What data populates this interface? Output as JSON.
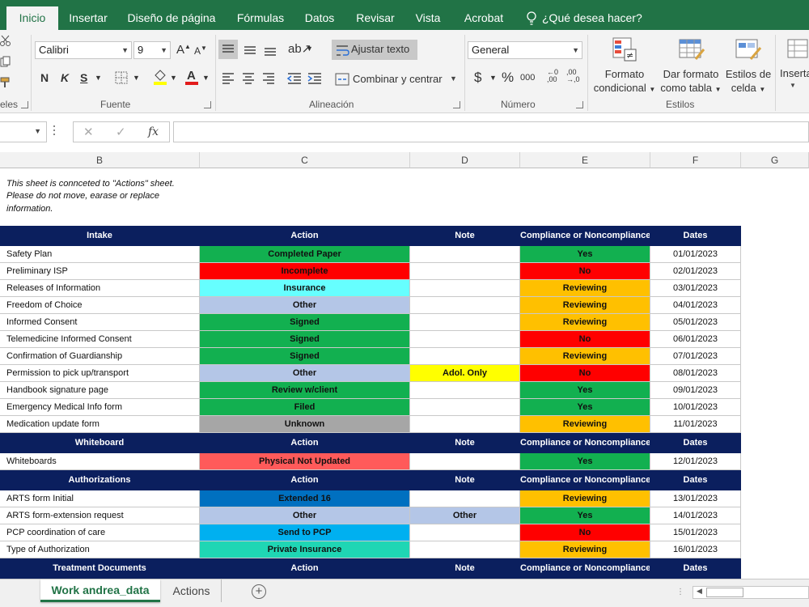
{
  "tabs": [
    "Inicio",
    "Insertar",
    "Diseño de página",
    "Fórmulas",
    "Datos",
    "Revisar",
    "Vista",
    "Acrobat",
    "¿Qué desea hacer?"
  ],
  "ribbon": {
    "font_name": "Calibri",
    "font_size": "9",
    "bold": "N",
    "italic": "K",
    "underline": "S",
    "wrap_text": "Ajustar texto",
    "merge_center": "Combinar y centrar",
    "number_format": "General",
    "currency": "$",
    "percent": "%",
    "thousands": "000",
    "cond_format": [
      "Formato",
      "condicional"
    ],
    "format_table": [
      "Dar formato",
      "como tabla"
    ],
    "cell_styles": [
      "Estilos de",
      "celda"
    ],
    "insert": "Inserta",
    "groups": {
      "clipboard": "eles",
      "font": "Fuente",
      "alignment": "Alineación",
      "number": "Número",
      "styles": "Estilos"
    }
  },
  "formula_bar": {
    "fx": "fx",
    "cancel": "✕",
    "enter": "✓"
  },
  "columns": [
    "B",
    "C",
    "D",
    "E",
    "F",
    "G"
  ],
  "notes": [
    "This sheet is connceted to \"Actions\" sheet.",
    "Please do not move, earase or replace",
    "information."
  ],
  "header_labels": {
    "action": "Action",
    "note": "Note",
    "compliance": "Compliance or Noncompliance",
    "dates": "Dates"
  },
  "sections": [
    {
      "title": "Intake",
      "rows": [
        {
          "item": "Safety Plan",
          "action": "Completed Paper",
          "note": "",
          "compliance": "Yes",
          "date": "01/01/2023"
        },
        {
          "item": "Preliminary ISP",
          "action": "Incomplete",
          "note": "",
          "compliance": "No",
          "date": "02/01/2023"
        },
        {
          "item": "Releases of Information",
          "action": "Insurance",
          "note": "",
          "compliance": "Reviewing",
          "date": "03/01/2023"
        },
        {
          "item": "Freedom of Choice",
          "action": "Other",
          "note": "",
          "compliance": "Reviewing",
          "date": "04/01/2023"
        },
        {
          "item": "Informed Consent",
          "action": "Signed",
          "note": "",
          "compliance": "Reviewing",
          "date": "05/01/2023"
        },
        {
          "item": "Telemedicine Informed Consent",
          "action": "Signed",
          "note": "",
          "compliance": "No",
          "date": "06/01/2023"
        },
        {
          "item": "Confirmation of Guardianship",
          "action": "Signed",
          "note": "",
          "compliance": "Reviewing",
          "date": "07/01/2023"
        },
        {
          "item": "Permission to pick up/transport",
          "action": "Other",
          "note": "Adol. Only",
          "compliance": "No",
          "date": "08/01/2023"
        },
        {
          "item": "Handbook signature page",
          "action": "Review w/client",
          "note": "",
          "compliance": "Yes",
          "date": "09/01/2023"
        },
        {
          "item": "Emergency Medical Info form",
          "action": "Filed",
          "note": "",
          "compliance": "Yes",
          "date": "10/01/2023"
        },
        {
          "item": "Medication update form",
          "action": "Unknown",
          "note": "",
          "compliance": "Reviewing",
          "date": "11/01/2023"
        }
      ]
    },
    {
      "title": "Whiteboard",
      "rows": [
        {
          "item": "Whiteboards",
          "action": "Physical Not Updated",
          "note": "",
          "compliance": "Yes",
          "date": "12/01/2023"
        }
      ]
    },
    {
      "title": "Authorizations",
      "rows": [
        {
          "item": "ARTS form Initial",
          "action": "Extended 16",
          "note": "",
          "compliance": "Reviewing",
          "date": "13/01/2023"
        },
        {
          "item": "ARTS form-extension request",
          "action": "Other",
          "note": "Other",
          "compliance": "Yes",
          "date": "14/01/2023"
        },
        {
          "item": "PCP coordination of care",
          "action": "Send to PCP",
          "note": "",
          "compliance": "No",
          "date": "15/01/2023"
        },
        {
          "item": "Type of Authorization",
          "action": "Private Insurance",
          "note": "",
          "compliance": "Reviewing",
          "date": "16/01/2023"
        }
      ]
    },
    {
      "title": "Treatment Documents",
      "rows": []
    }
  ],
  "action_colors": {
    "Completed Paper": "#12b050",
    "Incomplete": "#ff0000",
    "Insurance": "#66ffff",
    "Other": "#b4c6e7",
    "Signed": "#12b050",
    "Review w/client": "#12b050",
    "Filed": "#12b050",
    "Unknown": "#a6a6a6",
    "Physical Not Updated": "#ff5a5a",
    "Extended 16": "#0070c0",
    "Send to PCP": "#00b0f0",
    "Private Insurance": "#1fd6b4"
  },
  "compliance_colors": {
    "Yes": "#12b050",
    "No": "#ff0000",
    "Reviewing": "#ffc000"
  },
  "note_colors": {
    "Adol. Only": "#ffff00",
    "Other": "#b4c6e7"
  },
  "sheet_tabs": [
    "Work andrea_data",
    "Actions"
  ],
  "colors": {
    "excel_green": "#217346",
    "header_navy": "#0b1f5e"
  }
}
